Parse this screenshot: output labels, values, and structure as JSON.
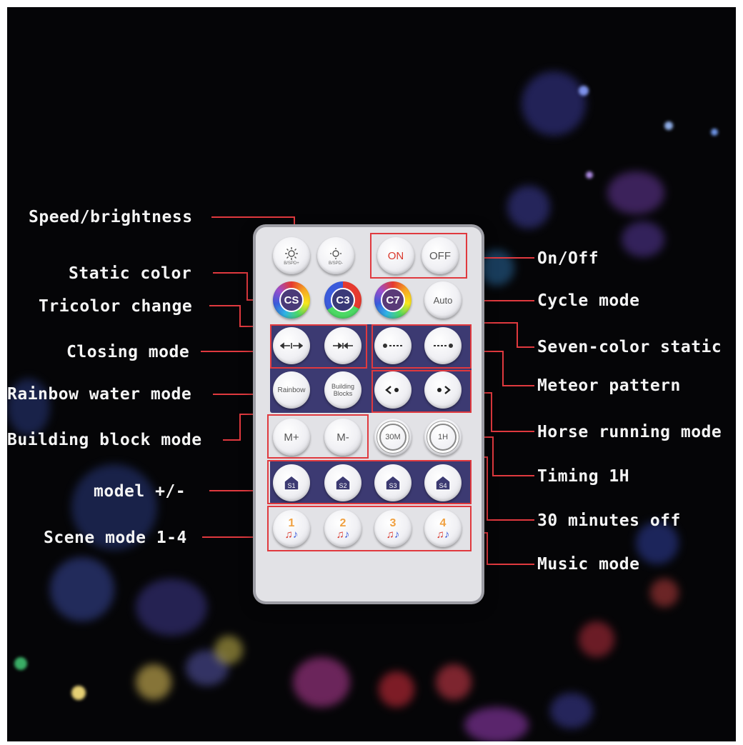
{
  "labels": {
    "speed_brightness": "Speed/brightness",
    "static_color": "Static color",
    "tricolor_change": "Tricolor change",
    "closing_mode": "Closing mode",
    "rainbow_water_mode": "Rainbow water mode",
    "building_block_mode": "Building block mode",
    "model_plus_minus": "model +/-",
    "scene_mode": "Scene mode 1-4",
    "on_off": "On/Off",
    "cycle_mode": "Cycle mode",
    "seven_color_static": "Seven-color static",
    "meteor_pattern": "Meteor pattern",
    "horse_running_mode": "Horse running mode",
    "timing_1h": "Timing 1H",
    "thirty_minutes_off": "30 minutes off",
    "music_mode": "Music mode"
  },
  "remote": {
    "bright_up_small": "B/SPD+",
    "bright_down_small": "B/SPD-",
    "on": "ON",
    "off": "OFF",
    "cs": "CS",
    "c3": "C3",
    "c7": "C7",
    "auto": "Auto",
    "rainbow": "Rainbow",
    "building": "Building",
    "blocks": "Blocks",
    "m_plus": "M+",
    "m_minus": "M-",
    "timer_30m": "30M",
    "timer_1h": "1H",
    "scenes": [
      "S1",
      "S2",
      "S3",
      "S4"
    ],
    "music": [
      "1",
      "2",
      "3",
      "4"
    ]
  },
  "colors": {
    "annotation_line": "#e0393e",
    "panel": "#3c3a72",
    "on_text": "#d9372b"
  },
  "icons": {
    "closing_left": "arrows-inward-icon",
    "closing_right": "arrows-inward-dots-icon",
    "meteor_left": "meteor-left-icon",
    "meteor_right": "meteor-right-icon",
    "horse_left": "chevron-left-dot-icon",
    "horse_right": "chevron-right-dot-icon",
    "scene": "house-icon",
    "music": "music-note-icon",
    "brightness": "sun-icon"
  }
}
